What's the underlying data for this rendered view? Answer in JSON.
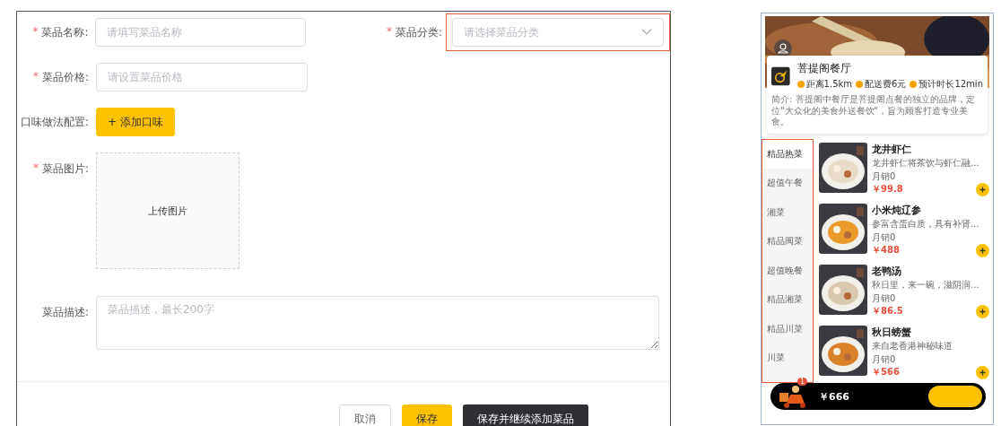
{
  "form": {
    "rows": [
      {
        "kind": "input",
        "mark": "*",
        "label": "菜品名称:",
        "placeholder": "请填写菜品名称",
        "side": {
          "kind": "select",
          "mark": "*",
          "label": "菜品分类:",
          "placeholder": "请选择菜品分类",
          "highlighted": true
        }
      },
      {
        "kind": "input",
        "mark": "*",
        "label": "菜品价格:",
        "placeholder": "请设置菜品价格"
      },
      {
        "kind": "button",
        "label": "口味做法配置:",
        "text": "+ 添加口味"
      },
      {
        "kind": "upload",
        "mark": "*",
        "label": "菜品图片:",
        "text": "上传图片"
      },
      {
        "kind": "textarea",
        "label": "菜品描述:",
        "placeholder": "菜品描述，最长200字"
      }
    ],
    "buttons": [
      {
        "kind": "plain",
        "text": "取消"
      },
      {
        "kind": "primary",
        "text": "保存"
      },
      {
        "kind": "dark",
        "text": "保存并继续添加菜品"
      }
    ]
  },
  "preview": {
    "restaurant": "菩提阁餐厅",
    "stats": [
      {
        "text": "距离1.5km"
      },
      {
        "text": "配送费6元"
      },
      {
        "text": "预计时长12min"
      }
    ],
    "intro": "简介: 菩提阁中餐厅是菩提阁点餐的独立的品牌，定位\"大众化的美食外送餐饮\"，旨为顾客打造专业美食。",
    "categories_highlighted": true,
    "categories": [
      {
        "label": "精品热菜",
        "selected": true
      },
      {
        "label": "超值午餐",
        "selected": false
      },
      {
        "label": "湘菜",
        "selected": false
      },
      {
        "label": "精品闽菜",
        "selected": false
      },
      {
        "label": "超值晚餐",
        "selected": false
      },
      {
        "label": "精品湘菜",
        "selected": false
      },
      {
        "label": "精品川菜",
        "selected": false
      },
      {
        "label": "川菜",
        "selected": false
      }
    ],
    "dishes": [
      {
        "name": "龙井虾仁",
        "desc": "龙井虾仁将茶饮与虾仁融...",
        "sales": "月销0",
        "price": "￥99.8"
      },
      {
        "name": "小米炖辽参",
        "desc": "参富含蛋白质，具有补肾...",
        "sales": "月销0",
        "price": "￥488"
      },
      {
        "name": "老鸭汤",
        "desc": "秋日里，来一碗，滋阴润...",
        "sales": "月销0",
        "price": "￥86.5"
      },
      {
        "name": "秋日螃蟹",
        "desc": "来自老香港神秘味道",
        "sales": "月销0",
        "price": "￥566"
      }
    ],
    "cart": {
      "badge": "1",
      "total": "￥666"
    }
  }
}
